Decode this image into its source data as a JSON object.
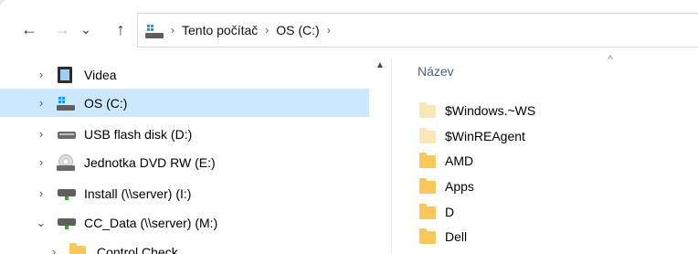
{
  "navigation": {
    "back_icon": "arrow-left-icon",
    "forward_icon": "arrow-right-icon",
    "recent_icon": "chevron-down-icon",
    "up_icon": "arrow-up-icon",
    "back_glyph": "←",
    "forward_glyph": "→",
    "recent_glyph": "⌄",
    "up_glyph": "↑"
  },
  "address_bar": {
    "crumbs": [
      "Tento počítač",
      "OS (C:)"
    ],
    "separator": "›"
  },
  "tree": {
    "items": [
      {
        "label": "Videa",
        "icon": "videos-folder-icon",
        "chevron": "›",
        "selected": false
      },
      {
        "label": "OS (C:)",
        "icon": "windows-drive-icon",
        "chevron": "›",
        "selected": true
      },
      {
        "label": "USB flash disk (D:)",
        "icon": "usb-drive-icon",
        "chevron": "›",
        "selected": false
      },
      {
        "label": "Jednotka DVD RW (E:)",
        "icon": "dvd-drive-icon",
        "chevron": "›",
        "selected": false
      },
      {
        "label": "Install (\\\\server) (I:)",
        "icon": "network-drive-icon",
        "chevron": "›",
        "selected": false
      },
      {
        "label": "CC_Data (\\\\server) (M:)",
        "icon": "network-drive-icon",
        "chevron": "⌄",
        "selected": false
      },
      {
        "label": "Control Check",
        "icon": "folder-icon",
        "chevron": "›",
        "selected": false
      }
    ]
  },
  "file_list": {
    "column_name": "Název",
    "sort_glyph": "^",
    "files": [
      {
        "name": "$Windows.~WS",
        "icon": "hidden-folder-icon"
      },
      {
        "name": "$WinREAgent",
        "icon": "hidden-folder-icon"
      },
      {
        "name": "AMD",
        "icon": "folder-icon"
      },
      {
        "name": "Apps",
        "icon": "folder-icon"
      },
      {
        "name": "D",
        "icon": "folder-icon"
      },
      {
        "name": "Dell",
        "icon": "folder-icon"
      }
    ]
  },
  "colors": {
    "selection": "#cce8ff",
    "folder": "#f8c85a",
    "hidden_folder": "#fbe7b4",
    "header_text": "#4c607a"
  }
}
